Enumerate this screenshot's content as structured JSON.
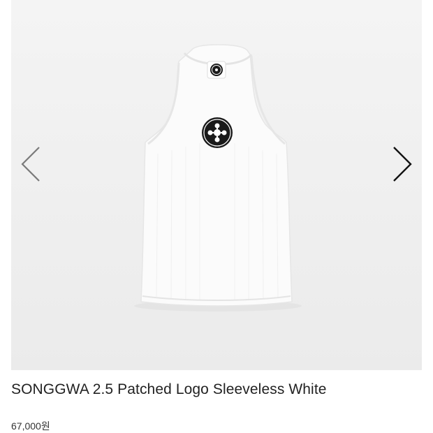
{
  "product": {
    "title": "SONGGWA 2.5 Patched Logo Sleeveless White",
    "price": "67,000원"
  },
  "carousel": {
    "prev_icon": "chevron-left-icon",
    "next_icon": "chevron-right-icon",
    "prev_color": "#7a7a7a",
    "next_color": "#111111"
  },
  "colors": {
    "image_background": "#efefef",
    "garment": "#fbfbfb",
    "logo": "#1a1a1a"
  }
}
